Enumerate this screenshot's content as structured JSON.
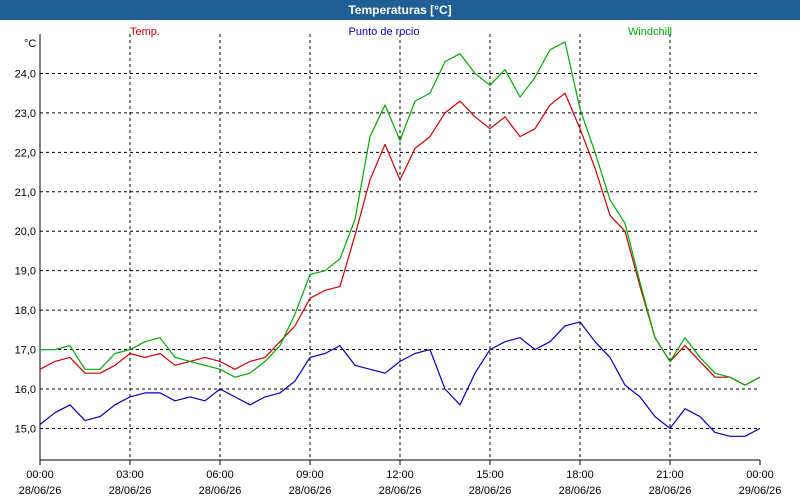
{
  "window": {
    "title": "Temperaturas [°C]"
  },
  "chart_data": {
    "type": "line",
    "unit": "°C",
    "ylim": [
      14.2,
      25.0
    ],
    "yticks": [
      15.0,
      16.0,
      17.0,
      18.0,
      19.0,
      20.0,
      21.0,
      22.0,
      23.0,
      24.0
    ],
    "ytick_labels": [
      "15,0",
      "16,0",
      "17,0",
      "18,0",
      "19,0",
      "20,0",
      "21,0",
      "22,0",
      "23,0",
      "24,0"
    ],
    "xlim": [
      0,
      24
    ],
    "xticks": [
      {
        "hour": 0,
        "time": "00:00",
        "date": "28/06/26"
      },
      {
        "hour": 3,
        "time": "03:00",
        "date": "28/06/26"
      },
      {
        "hour": 6,
        "time": "06:00",
        "date": "28/06/26"
      },
      {
        "hour": 9,
        "time": "09:00",
        "date": "28/06/26"
      },
      {
        "hour": 12,
        "time": "12:00",
        "date": "28/06/26"
      },
      {
        "hour": 15,
        "time": "15:00",
        "date": "28/06/26"
      },
      {
        "hour": 18,
        "time": "18:00",
        "date": "28/06/26"
      },
      {
        "hour": 21,
        "time": "21:00",
        "date": "28/06/26"
      },
      {
        "hour": 24,
        "time": "00:00",
        "date": "29/06/26"
      }
    ],
    "grid": true,
    "legend_placement": "top",
    "series": [
      {
        "name": "Temp.",
        "color": "#cc0000",
        "x": [
          0,
          0.5,
          1,
          1.5,
          2,
          2.5,
          3,
          3.5,
          4,
          4.5,
          5,
          5.5,
          6,
          6.5,
          7,
          7.5,
          8,
          8.5,
          9,
          9.5,
          10,
          10.5,
          11,
          11.5,
          12,
          12.5,
          13,
          13.5,
          14,
          14.5,
          15,
          15.5,
          16,
          16.5,
          17,
          17.5,
          18,
          18.5,
          19,
          19.5,
          20,
          20.5,
          21,
          21.5,
          22,
          22.5,
          23,
          23.5,
          24
        ],
        "y": [
          16.5,
          16.7,
          16.8,
          16.4,
          16.4,
          16.6,
          16.9,
          16.8,
          16.9,
          16.6,
          16.7,
          16.8,
          16.7,
          16.5,
          16.7,
          16.8,
          17.2,
          17.6,
          18.3,
          18.5,
          18.6,
          19.9,
          21.3,
          22.2,
          21.3,
          22.1,
          22.4,
          23.0,
          23.3,
          22.9,
          22.6,
          22.9,
          22.4,
          22.6,
          23.2,
          23.5,
          22.6,
          21.6,
          20.4,
          20.0,
          18.6,
          17.3,
          16.7,
          17.1,
          16.7,
          16.3,
          16.3,
          16.1,
          16.3
        ]
      },
      {
        "name": "Punto de rocio",
        "color": "#0000bb",
        "x": [
          0,
          0.5,
          1,
          1.5,
          2,
          2.5,
          3,
          3.5,
          4,
          4.5,
          5,
          5.5,
          6,
          6.5,
          7,
          7.5,
          8,
          8.5,
          9,
          9.5,
          10,
          10.5,
          11,
          11.5,
          12,
          12.5,
          13,
          13.5,
          14,
          14.5,
          15,
          15.5,
          16,
          16.5,
          17,
          17.5,
          18,
          18.5,
          19,
          19.5,
          20,
          20.5,
          21,
          21.5,
          22,
          22.5,
          23,
          23.5,
          24
        ],
        "y": [
          15.1,
          15.4,
          15.6,
          15.2,
          15.3,
          15.6,
          15.8,
          15.9,
          15.9,
          15.7,
          15.8,
          15.7,
          16.0,
          15.8,
          15.6,
          15.8,
          15.9,
          16.2,
          16.8,
          16.9,
          17.1,
          16.6,
          16.5,
          16.4,
          16.7,
          16.9,
          17.0,
          16.0,
          15.6,
          16.4,
          17.0,
          17.2,
          17.3,
          17.0,
          17.2,
          17.6,
          17.7,
          17.2,
          16.8,
          16.1,
          15.8,
          15.3,
          15.0,
          15.5,
          15.3,
          14.9,
          14.8,
          14.8,
          15.0
        ]
      },
      {
        "name": "Windchill",
        "color": "#00aa00",
        "x": [
          0,
          0.5,
          1,
          1.5,
          2,
          2.5,
          3,
          3.5,
          4,
          4.5,
          5,
          5.5,
          6,
          6.5,
          7,
          7.5,
          8,
          8.5,
          9,
          9.5,
          10,
          10.5,
          11,
          11.5,
          12,
          12.5,
          13,
          13.5,
          14,
          14.5,
          15,
          15.5,
          16,
          16.5,
          17,
          17.5,
          18,
          18.5,
          19,
          19.5,
          20,
          20.5,
          21,
          21.5,
          22,
          22.5,
          23,
          23.5,
          24
        ],
        "y": [
          17.0,
          17.0,
          17.1,
          16.5,
          16.5,
          16.9,
          17.0,
          17.2,
          17.3,
          16.8,
          16.7,
          16.6,
          16.5,
          16.3,
          16.4,
          16.7,
          17.1,
          17.9,
          18.9,
          19.0,
          19.3,
          20.3,
          22.4,
          23.2,
          22.3,
          23.3,
          23.5,
          24.3,
          24.5,
          24.0,
          23.7,
          24.1,
          23.4,
          23.9,
          24.6,
          24.8,
          23.1,
          22.0,
          20.8,
          20.2,
          18.7,
          17.3,
          16.7,
          17.3,
          16.8,
          16.4,
          16.3,
          16.1,
          16.3
        ]
      }
    ]
  }
}
